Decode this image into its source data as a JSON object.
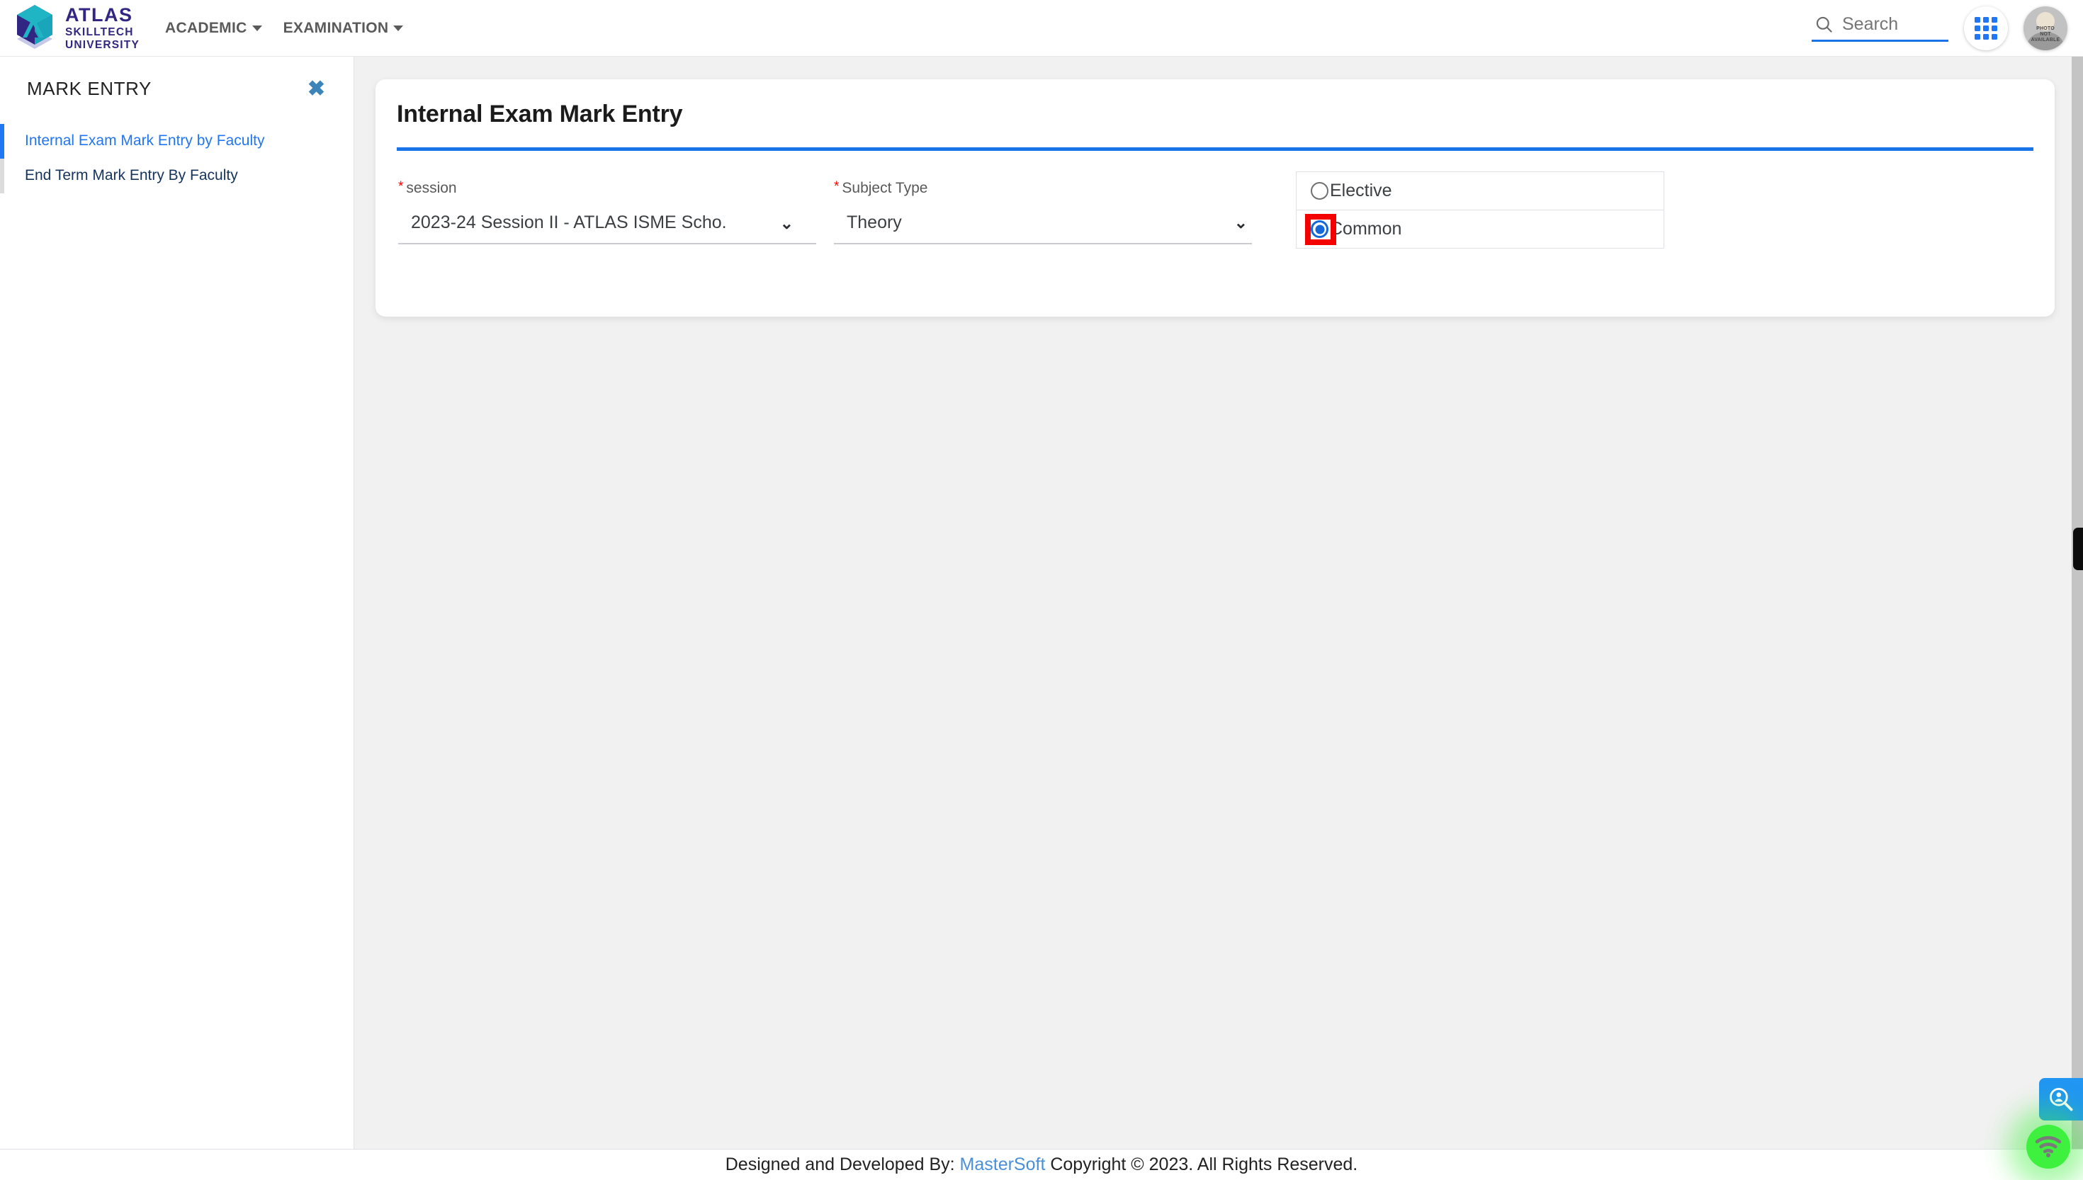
{
  "navbar": {
    "logo": {
      "line1": "ATLAS",
      "line2": "SKILLTECH",
      "line3": "UNIVERSITY",
      "icon": "cube-logo-icon"
    },
    "menu": [
      {
        "label": "ACADEMIC",
        "icon": "chevron-down-icon"
      },
      {
        "label": "EXAMINATION",
        "icon": "chevron-down-icon"
      }
    ],
    "search": {
      "placeholder": "Search",
      "value": "",
      "icon": "search-icon",
      "underline_color": "#1a73e8"
    },
    "apps_icon": "apps-grid-icon",
    "avatar": {
      "icon": "avatar-icon",
      "text_line1": "PHOTO",
      "text_line2": "NOT",
      "text_line3": "AVAILABLE"
    }
  },
  "sidebar": {
    "title": "MARK ENTRY",
    "close_icon": "close-icon",
    "items": [
      {
        "label": "Internal Exam Mark Entry by Faculty",
        "active": true
      },
      {
        "label": "End Term Mark Entry By Faculty",
        "active": false
      }
    ]
  },
  "card": {
    "title": "Internal Exam Mark Entry",
    "accent_color": "#1a73e8",
    "fields": [
      {
        "label": "session",
        "required": true,
        "value": "2023-24 Session II - ATLAS ISME Scho.",
        "icon": "chevron-down-icon"
      },
      {
        "label": "Subject Type",
        "required": true,
        "value": "Theory",
        "icon": "chevron-down-icon"
      }
    ],
    "radio_group": {
      "options": [
        {
          "label": "Elective",
          "selected": false
        },
        {
          "label": "Common",
          "selected": true
        }
      ],
      "selected_color": "#1668d8",
      "annotation_color": "#f50000"
    }
  },
  "footer": {
    "prefix": "Designed and Developed By:",
    "link": "MasterSoft",
    "suffix": "Copyright © 2023. All Rights Reserved.",
    "link_color": "#4a90d9"
  },
  "widgets": {
    "support": {
      "icon": "person-search-icon",
      "color": "#2196f3"
    },
    "connection": {
      "icon": "wifi-icon",
      "color": "#3ff13f"
    }
  }
}
